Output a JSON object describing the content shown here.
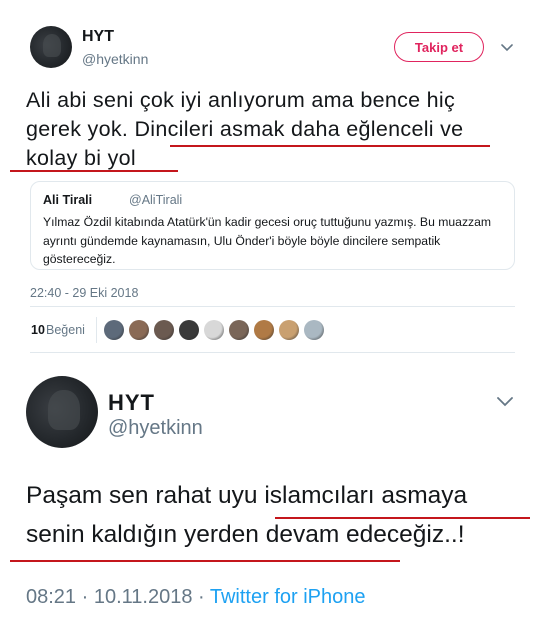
{
  "tweet1": {
    "display_name": "HYT",
    "handle": "@hyetkinn",
    "follow_label": "Takip et",
    "text_line1": "Ali abi seni çok iyi anlıyorum ama bence hiç",
    "text_line2": "gerek yok. Dincileri asmak daha eğlenceli ve",
    "text_line3": "kolay bi yol",
    "quoted": {
      "display_name": "Ali Tirali",
      "handle": "@AliTirali",
      "text_line1": "Yılmaz Özdil kitabında Atatürk'ün kadir gecesi oruç tuttuğunu yazmış. Bu muazzam",
      "text_line2": "ayrıntı gündemde kaynamasın, Ulu Önder'i böyle böyle dincilere sempatik",
      "text_line3": "göstereceğiz."
    },
    "timestamp": "22:40 - 29 Eki 2018",
    "likes_count": "10",
    "likes_label": "Beğeni",
    "liker_colors": [
      "#5d6a7a",
      "#8a6a55",
      "#6b5a50",
      "#3a3a3a",
      "#d8d8d8",
      "#7a6658",
      "#b07a45",
      "#c9a070",
      "#aab8c2"
    ]
  },
  "tweet2": {
    "display_name": "HYT",
    "handle": "@hyetkinn",
    "text_line1": "Paşam sen rahat uyu islamcıları asmaya",
    "text_line2": "senin kaldığın yerden devam edeceğiz..!",
    "timestamp": "08:21 · 10.11.2018 · ",
    "source": "Twitter for iPhone"
  },
  "colors": {
    "accent_pink": "#e0245e",
    "twitter_blue": "#1da1f2",
    "underline_red": "#c4161c",
    "secondary_text": "#657786"
  },
  "icons": {
    "tweet1_menu": "chevron-down-icon",
    "tweet2_menu": "chevron-down-icon"
  }
}
